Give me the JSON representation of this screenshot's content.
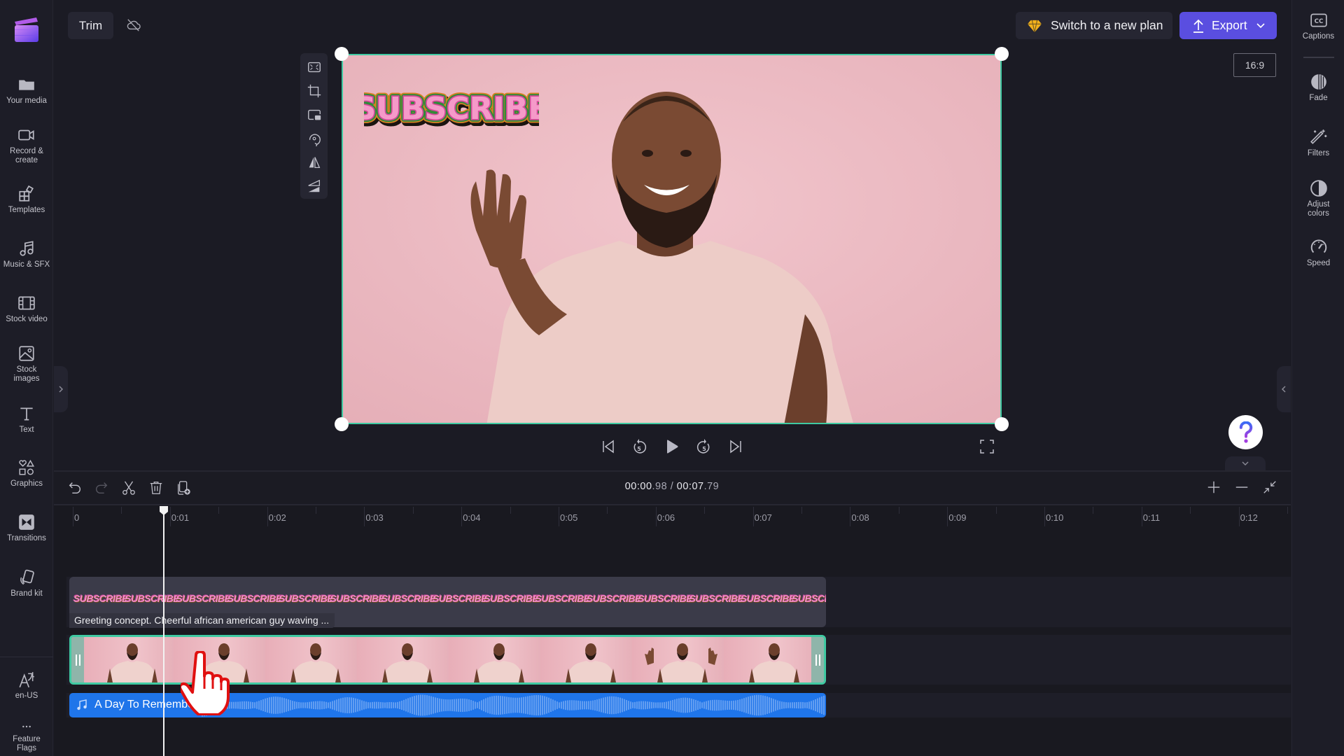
{
  "app": {
    "brand_colors": {
      "accent": "#5a4ee0",
      "selection": "#3fcaa2",
      "audio_clip": "#1f75ea",
      "background": "#1b1b24"
    }
  },
  "left_sidebar": {
    "items": [
      {
        "label": "Your media",
        "icon": "folder-icon"
      },
      {
        "label": "Record & create",
        "icon": "camera-icon"
      },
      {
        "label": "Templates",
        "icon": "templates-icon"
      },
      {
        "label": "Music & SFX",
        "icon": "music-note-icon"
      },
      {
        "label": "Stock video",
        "icon": "film-icon"
      },
      {
        "label": "Stock images",
        "icon": "image-icon"
      },
      {
        "label": "Text",
        "icon": "text-icon"
      },
      {
        "label": "Graphics",
        "icon": "shapes-icon"
      },
      {
        "label": "Transitions",
        "icon": "transitions-icon"
      },
      {
        "label": "Brand kit",
        "icon": "brand-kit-icon"
      }
    ],
    "bottom_items": [
      {
        "label": "en-US",
        "icon": "language-icon"
      },
      {
        "label": "Feature Flags",
        "icon": "more-icon"
      }
    ]
  },
  "topbar": {
    "trim_label": "Trim",
    "cloud_status_icon": "cloud-off-icon",
    "plan_label": "Switch to a new plan",
    "export_label": "Export",
    "aspect_ratio": "16:9"
  },
  "right_sidebar": {
    "items": [
      {
        "label": "Captions",
        "icon": "captions-icon"
      },
      {
        "label": "Fade",
        "icon": "fade-icon"
      },
      {
        "label": "Filters",
        "icon": "magic-wand-icon"
      },
      {
        "label": "Adjust colors",
        "icon": "contrast-icon"
      },
      {
        "label": "Speed",
        "icon": "speedometer-icon"
      }
    ]
  },
  "preview": {
    "sticker_text": "SUBSCRIBE",
    "tools": [
      "fit-icon",
      "crop-icon",
      "picture-in-picture-icon",
      "rotate-icon",
      "flip-horizontal-icon",
      "flip-vertical-icon"
    ]
  },
  "playback": {
    "skip_back_seconds": "5",
    "skip_forward_seconds": "5"
  },
  "help": {
    "label": "?"
  },
  "timeline": {
    "current_time_main": "00:00",
    "current_time_frac": ".98",
    "separator": "/",
    "total_time_main": "00:07",
    "total_time_frac": ".79",
    "ruler_labels": [
      "0",
      "0:01",
      "0:02",
      "0:03",
      "0:04",
      "0:05",
      "0:06",
      "0:07",
      "0:08",
      "0:09",
      "0:10",
      "0:11",
      "0:12"
    ],
    "playhead_seconds": 0.98,
    "tracks": {
      "sticker": {
        "repeat_label": "SUBSCRIBE",
        "repeat_count": 15
      },
      "video": {
        "title": "Greeting concept. Cheerful african american guy waving ...",
        "frame_count": 8
      },
      "audio": {
        "title": "A Day To Remember"
      }
    }
  }
}
